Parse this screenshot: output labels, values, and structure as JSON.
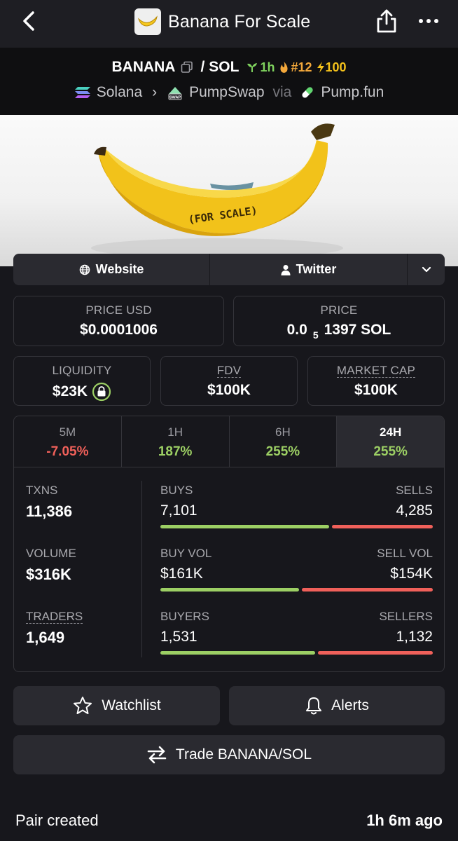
{
  "header": {
    "title": "Banana For Scale"
  },
  "pair": {
    "base": "BANANA",
    "separator": "/",
    "quote": "SOL",
    "age": "1h",
    "rank": "#12",
    "boosts": "100",
    "chain": "Solana",
    "dex": "PumpSwap",
    "via_label": "via",
    "launchpad": "Pump.fun",
    "dex_logo_text": "SWAP"
  },
  "links": {
    "website": "Website",
    "twitter": "Twitter"
  },
  "banner": {
    "text": "(FOR SCALE)"
  },
  "price": {
    "usd_label": "PRICE USD",
    "usd_value": "$0.0001006",
    "native_label": "PRICE",
    "native_prefix": "0.0",
    "native_subscript": "5",
    "native_rest": "1397 SOL"
  },
  "metrics": {
    "liquidity_label": "LIQUIDITY",
    "liquidity_value": "$23K",
    "fdv_label": "FDV",
    "fdv_value": "$100K",
    "mcap_label": "MARKET CAP",
    "mcap_value": "$100K"
  },
  "timeframes": [
    {
      "label": "5M",
      "value": "-7.05%"
    },
    {
      "label": "1H",
      "value": "187%"
    },
    {
      "label": "6H",
      "value": "255%"
    },
    {
      "label": "24H",
      "value": "255%"
    }
  ],
  "stats": {
    "txns_label": "TXNS",
    "txns_value": "11,386",
    "volume_label": "VOLUME",
    "volume_value": "$316K",
    "traders_label": "TRADERS",
    "traders_value": "1,649",
    "buys_label": "BUYS",
    "buys_value": "7,101",
    "sells_label": "SELLS",
    "sells_value": "4,285",
    "buyvol_label": "BUY VOL",
    "buyvol_value": "$161K",
    "sellvol_label": "SELL VOL",
    "sellvol_value": "$154K",
    "buyers_label": "BUYERS",
    "buyers_value": "1,531",
    "sellers_label": "SELLERS",
    "sellers_value": "1,132"
  },
  "actions": {
    "watchlist": "Watchlist",
    "alerts": "Alerts",
    "trade": "Trade BANANA/SOL"
  },
  "footer": {
    "label": "Pair created",
    "value": "1h 6m ago"
  },
  "colors": {
    "positive": "#9ccf64",
    "negative": "#f0605a",
    "background": "#17171c"
  }
}
